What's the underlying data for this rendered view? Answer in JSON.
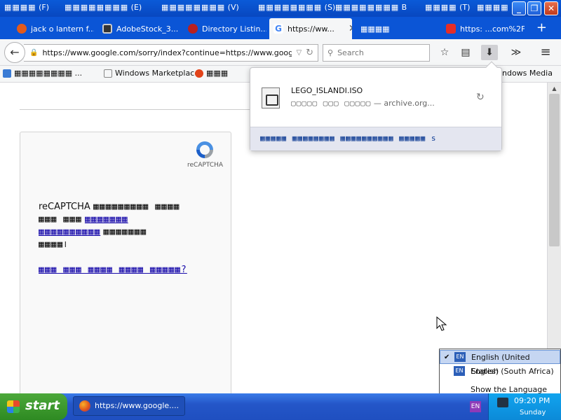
{
  "menu": {
    "items": [
      "(F)",
      "(E)",
      "(V)",
      "(S)",
      "B",
      "(T)"
    ],
    "glyph": "▦▦▦▦",
    "glyph_long": "▦▦▦▦▦▦▦▦"
  },
  "window_buttons": {
    "minimize": "_",
    "restore": "❐",
    "close": "✕"
  },
  "tabs": [
    {
      "label": "jack o lantern f...",
      "icon": "tor-icon",
      "color": "#e25a1c"
    },
    {
      "label": "AdobeStock_3...",
      "icon": "adobe-stock-icon",
      "color": "#333333"
    },
    {
      "label": "Directory Listin...",
      "icon": "directory-icon",
      "color": "#b82020"
    },
    {
      "label": "https://ww...",
      "icon": "google-icon",
      "color": "#4285f4",
      "active": true,
      "close": "✕"
    },
    {
      "label": "▦▦▦▦",
      "icon": "",
      "color": ""
    },
    {
      "label": "https: ...com%2F",
      "icon": "youtube-icon",
      "color": "#e52d27"
    }
  ],
  "new_tab": "+",
  "nav": {
    "back": "←",
    "url": "https://www.google.com/sorry/index?continue=https://www.google.com",
    "lock": "🔒",
    "dropdown": "▽",
    "reload": "↻",
    "search_placeholder": "Search",
    "bookmark_star": "☆",
    "reader": "▤",
    "download": "⬇",
    "overflow": "≫",
    "menu": "≡"
  },
  "bookmarks": [
    {
      "label": "▦▦▦▦▦▦▦▦ ...",
      "icon": "search-bookmark-icon"
    },
    {
      "label": "Windows Marketplace",
      "icon": "page-icon"
    },
    {
      "label": "▦▦▦",
      "icon": "opera-icon"
    },
    {
      "label": "ndows Media",
      "icon": ""
    }
  ],
  "captcha": {
    "logo_label": "reCAPTCHA",
    "line1_prefix": "reCAPTCHA",
    "line1_glyphs": "▦▦▦▦▦▦▦▦▦ ▦▦▦▦",
    "line2_glyphs": "▦▦▦ ▦▦▦",
    "line2_link": "▦▦▦▦▦▦▦",
    "line3_link": "▦▦▦▦▦▦▦▦▦▦",
    "line3_glyphs": "▦▦▦▦▦▦▦",
    "line4_glyphs": "▦▦▦▦।",
    "help_link": "▦▦▦ ▦▦▦ ▦▦▦▦ ▦▦▦▦ ▦▦▦▦▦?"
  },
  "download_panel": {
    "filename": "LEGO_ISLANDI.ISO",
    "status_glyphs": "▢▢▢▢▢ ▢▢▢ ▢▢▢▢▢",
    "status_source": "— archive.org...",
    "retry": "↻",
    "show_all": "▦▦▦▦▦ ▦▦▦▦▦▦▦▦ ▦▦▦▦▦▦▦▦▦▦ ▦▦▦▦▦ s"
  },
  "language_menu": {
    "items": [
      {
        "label": "English (United States)",
        "badge": "EN",
        "checked": true
      },
      {
        "label": "English (South Africa)",
        "badge": "EN",
        "checked": false
      }
    ],
    "check": "✔",
    "show_bar": "Show the Language bar"
  },
  "taskbar": {
    "start": "start",
    "task_label": "https://www.google....",
    "lang_indicator": "EN",
    "clock": "09:20 PM",
    "day": "Sunday"
  },
  "colors": {
    "xp_blue": "#0b55d6",
    "start_green": "#2e8a22",
    "link": "#1a0dab"
  }
}
